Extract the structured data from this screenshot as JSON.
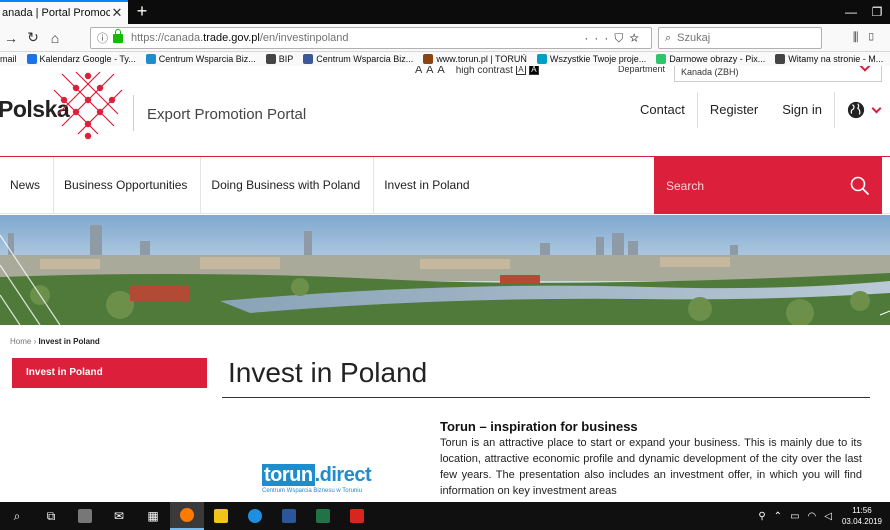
{
  "browser": {
    "tab_title": "anada | Portal Promocji Ekspo",
    "tab_close": "✕",
    "new_tab": "+",
    "url_host_prefix": "https://canada.",
    "url_host_main": "trade.gov.pl",
    "url_path": "/en/investinpoland",
    "search_placeholder": "Szukaj",
    "bookmarks": [
      {
        "label": "mail",
        "color": ""
      },
      {
        "label": "Kalendarz Google - Ty...",
        "color": "#1a73e8"
      },
      {
        "label": "Centrum Wsparcia Biz...",
        "color": "#1f8ccc"
      },
      {
        "label": "BIP",
        "color": "#444444"
      },
      {
        "label": "Centrum Wsparcia Biz...",
        "color": "#3b5998"
      },
      {
        "label": "www.torun.pl | TORUŃ",
        "color": "#8b4513"
      },
      {
        "label": "Wszystkie Twoje proje...",
        "color": "#00a0c6"
      },
      {
        "label": "Darmowe obrazy - Pix...",
        "color": "#2ec66d"
      },
      {
        "label": "Witamy na stronie - M...",
        "color": "#444444"
      }
    ]
  },
  "header": {
    "font_sizes_label": "A A A",
    "high_contrast_label": "high contrast",
    "hc_normal": "A",
    "hc_dark": "A",
    "department_label": "Department",
    "department_value": "Kanada (ZBH)",
    "logo_text": "Polska",
    "portal_title": "Export Promotion Portal",
    "links": {
      "contact": "Contact",
      "register": "Register",
      "sign_in": "Sign in"
    }
  },
  "nav": {
    "items": [
      "News",
      "Business Opportunities",
      "Doing Business with Poland",
      "Invest in Poland"
    ],
    "search_placeholder": "Search"
  },
  "content": {
    "breadcrumb_home": "Home",
    "breadcrumb_sep": " › ",
    "breadcrumb_current": "Invest in Poland",
    "side_active": "Invest in Poland",
    "heading": "Invest in Poland",
    "torun_logo_main_a": "torun",
    "torun_logo_main_b": ".direct",
    "torun_logo_sub": "Centrum Wsparcia Biznesu w Toruniu",
    "article_title": "Torun – inspiration for business",
    "article_body": "Torun is an attractive place to start or expand your business. This is mainly due to its location, attractive economic profile and dynamic development of the city over the last few years. The presentation also includes an investment offer, in which you will find information on key investment areas"
  },
  "taskbar": {
    "clock_time": "11:56",
    "clock_date": "03.04.2019"
  },
  "colors": {
    "brand_red": "#dc1f3b",
    "torun_blue": "#1f8ccc"
  }
}
